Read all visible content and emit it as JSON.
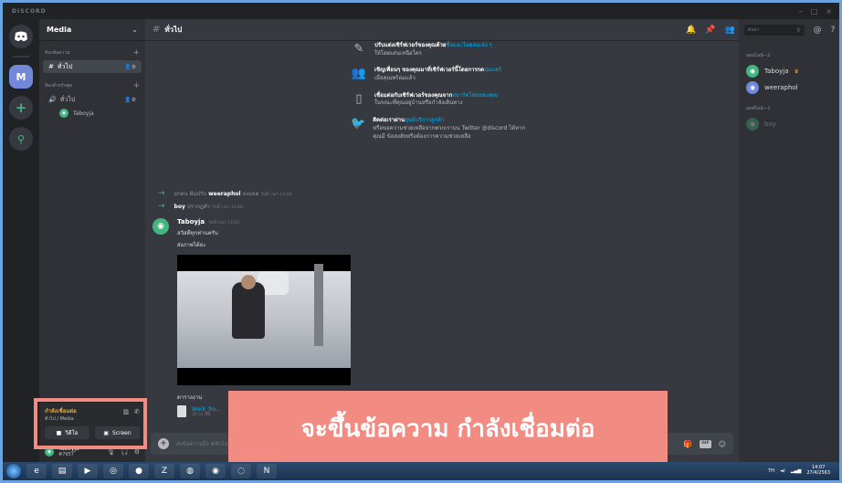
{
  "window": {
    "app_name": "DISCORD",
    "controls": [
      "–",
      "□",
      "×"
    ]
  },
  "guilds": {
    "home_icon": "discord-icon",
    "server_initial": "M",
    "add_icon": "+",
    "explore_icon": "⚲"
  },
  "server": {
    "name": "Media",
    "categories": [
      {
        "label": "ห้องข้อความ",
        "channels": [
          {
            "name": "ทั่วไป",
            "selected": true
          }
        ]
      },
      {
        "label": "ห้องสำหรับพูด",
        "channels": [
          {
            "name": "ทั่วไป"
          }
        ],
        "voice_users": [
          "Taboyja"
        ]
      }
    ]
  },
  "voice_panel": {
    "status": "กำลังเชื่อมต่อ",
    "location": "ทั่วไป / Media",
    "video_label": "วิดีโอ",
    "screen_label": "Screen"
  },
  "user_panel": {
    "name": "Taboyja",
    "tag": "#7957"
  },
  "channel": {
    "name": "ทั่วไป"
  },
  "welcome": [
    {
      "bold": "ปรับแต่งเซิร์ฟเวอร์ของคุณด้วย",
      "link": "ชื่อและไอคอนเจ๋ง ๆ",
      "rest": "ให้โดดเด่นเหนือใคร"
    },
    {
      "bold": "เชิญเพื่อนๆ ของคุณมาที่เซิร์ฟเวอร์นี้โดยการกด",
      "link": "ปุ่มแชร์",
      "rest": "เมื่อคุณพร้อมแล้ว"
    },
    {
      "bold": "เชื่อมต่อกับเซิร์ฟเวอร์ของคุณจาก",
      "link": "สมาร์ทโฟนของคุณ",
      "rest": "ในขณะที่คุณอยู่บ้านหรือกำลังเดินทาง"
    },
    {
      "bold": "ติดต่อเราผ่าน",
      "link": "ศูนย์บริการลูกค้า",
      "rest": "หรือขอความช่วยเหลือจากพวกเราบน Twitter @discord ได้หากคุณมี ข้อสงสัยหรือต้องการความช่วยเหลือ"
    }
  ],
  "system_messages": [
    {
      "prefix": "ยกคน ฝันปรับ",
      "user": "weeraphol",
      "suffix": "ลงมอต",
      "time": "วันนี้ เวลา 12:49"
    },
    {
      "prefix": "",
      "user": "boy",
      "suffix": "ปรากฏตัว",
      "time": "วันนี้ เวลา 12:49"
    }
  ],
  "message": {
    "author": "Taboyja",
    "time": "วันนี้ เวลา 13:50",
    "lines": [
      "สวัสดีทุกท่านครับ",
      "ส่งภาพได้ยะ"
    ],
    "attachment_label": "ตารางงาน",
    "file_name": "Work_fro...",
    "file_size": "26.51 KB"
  },
  "composer": {
    "placeholder": "ส่งข้อความถึง #ทั่วไป"
  },
  "search": {
    "placeholder": "ค้นหา"
  },
  "members": {
    "online_label": "ออนไลน์—2",
    "offline_label": "ออฟไลน์—1",
    "online": [
      {
        "name": "Taboyja",
        "owner": true
      },
      {
        "name": "weeraphol"
      }
    ],
    "offline": [
      {
        "name": "boy"
      }
    ]
  },
  "annotation": "จะขึ้นข้อความ กำลังเชื่อมต่อ",
  "taskbar": {
    "lang": "TH",
    "time": "14:07",
    "date": "27/4/2563"
  },
  "colors": {
    "accent": "#7289da",
    "annotation": "#f28b82",
    "status": "#faa61a",
    "online": "#43b581"
  }
}
